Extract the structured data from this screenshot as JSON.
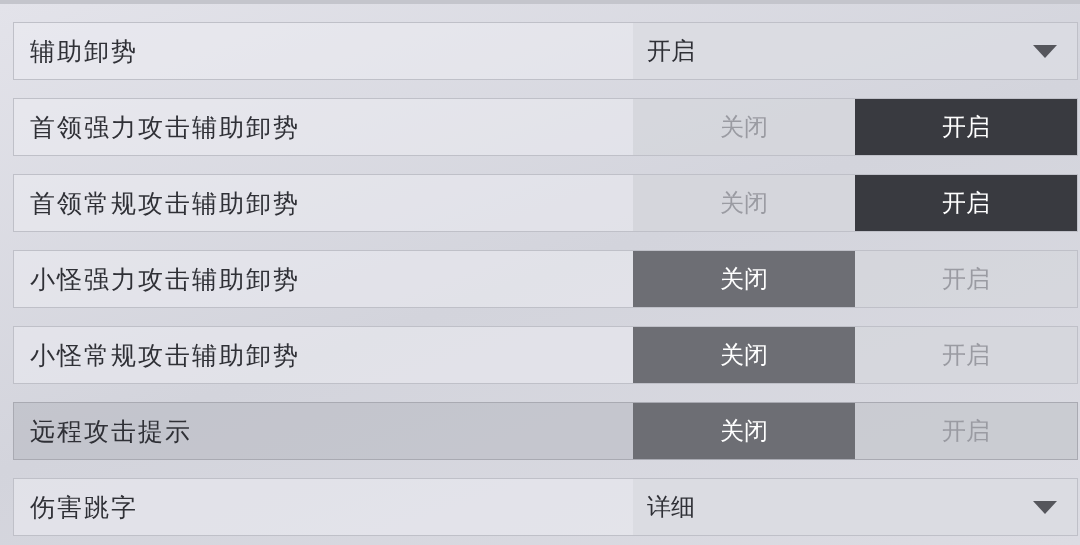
{
  "settings": [
    {
      "kind": "dropdown",
      "label": "辅助卸势",
      "value": "开启",
      "selected": false
    },
    {
      "kind": "toggle",
      "label": "首领强力攻击辅助卸势",
      "options": [
        {
          "label": "关闭",
          "selected": false
        },
        {
          "label": "开启",
          "selected": true
        }
      ],
      "selected": false
    },
    {
      "kind": "toggle",
      "label": "首领常规攻击辅助卸势",
      "options": [
        {
          "label": "关闭",
          "selected": false
        },
        {
          "label": "开启",
          "selected": true
        }
      ],
      "selected": false
    },
    {
      "kind": "toggle",
      "label": "小怪强力攻击辅助卸势",
      "options": [
        {
          "label": "关闭",
          "selected": true
        },
        {
          "label": "开启",
          "selected": false
        }
      ],
      "selected": false
    },
    {
      "kind": "toggle",
      "label": "小怪常规攻击辅助卸势",
      "options": [
        {
          "label": "关闭",
          "selected": true
        },
        {
          "label": "开启",
          "selected": false
        }
      ],
      "selected": false
    },
    {
      "kind": "toggle",
      "label": "远程攻击提示",
      "options": [
        {
          "label": "关闭",
          "selected": true
        },
        {
          "label": "开启",
          "selected": false
        }
      ],
      "selected": true
    },
    {
      "kind": "dropdown",
      "label": "伤害跳字",
      "value": "详细",
      "selected": false
    }
  ]
}
